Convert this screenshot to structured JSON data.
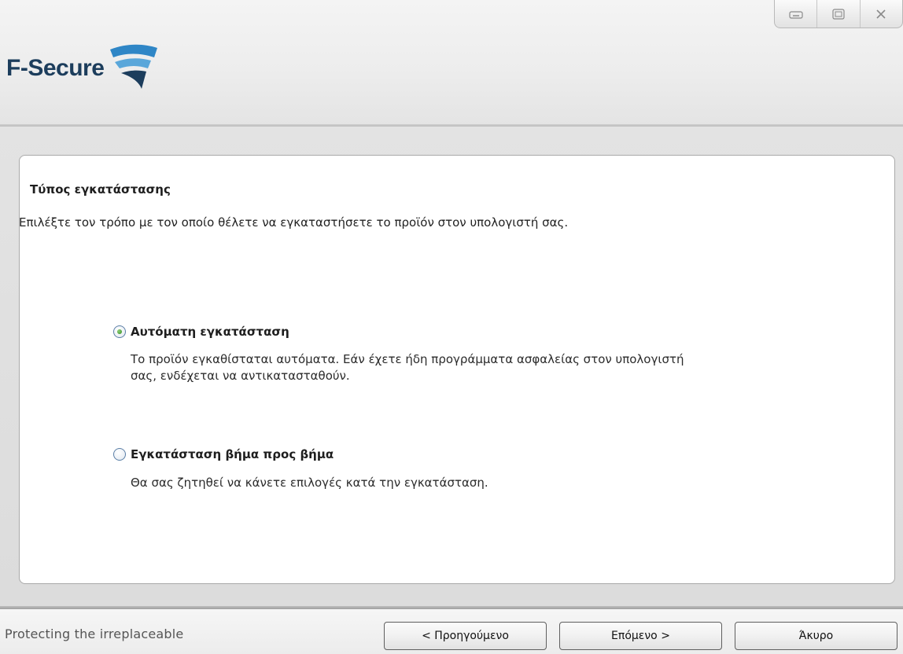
{
  "header": {
    "logo_text": "F-Secure"
  },
  "window_controls": {
    "icons": [
      "minimize-icon",
      "maximize-icon",
      "close-icon"
    ]
  },
  "page": {
    "title": "Τύπος εγκατάστασης",
    "description": "Επιλέξτε τον τρόπο με τον οποίο θέλετε να εγκαταστήσετε το προϊόν στον υπολογιστή σας."
  },
  "options": [
    {
      "label": "Αυτόματη εγκατάσταση",
      "description_line1": "Το προϊόν εγκαθίσταται αυτόματα. Εάν έχετε ήδη προγράμματα ασφαλείας στον υπολογιστή",
      "description_line2": "σας, ενδέχεται να αντικατασταθούν.",
      "selected": true
    },
    {
      "label": "Εγκατάσταση βήμα προς βήμα",
      "description_line1": "Θα σας ζητηθεί να κάνετε επιλογές κατά την εγκατάσταση.",
      "selected": false
    }
  ],
  "footer": {
    "tagline": "Protecting the irreplaceable",
    "back_label": "< Προηγούμενο",
    "next_label": "Επόμενο >",
    "cancel_label": "Άκυρο"
  },
  "colors": {
    "brand": "#1c3d5c",
    "brand_accent": "#2f86c6",
    "radio_selected": "#2f8a1e"
  }
}
